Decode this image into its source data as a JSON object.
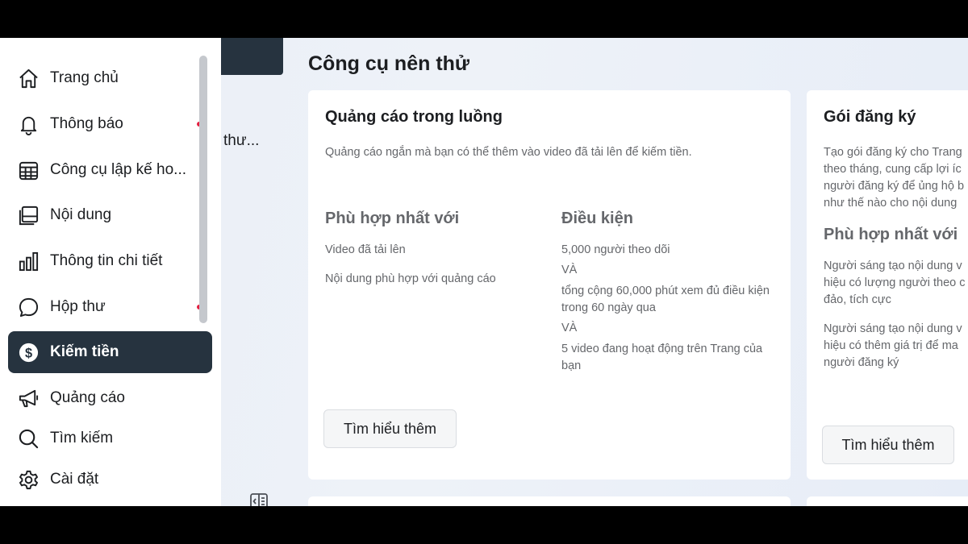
{
  "sidebar": {
    "items": [
      {
        "label": "Trang chủ",
        "icon": "home-icon"
      },
      {
        "label": "Thông báo",
        "icon": "bell-icon"
      },
      {
        "label": "Công cụ lập kế ho...",
        "icon": "calendar-icon"
      },
      {
        "label": "Nội dung",
        "icon": "content-icon"
      },
      {
        "label": "Thông tin chi tiết",
        "icon": "bar-chart-icon"
      },
      {
        "label": "Hộp thư",
        "icon": "chat-bubble-icon"
      },
      {
        "label": "Kiếm tiền",
        "icon": "dollar-icon"
      },
      {
        "label": "Quảng cáo",
        "icon": "megaphone-icon"
      },
      {
        "label": "Tìm kiếm",
        "icon": "search-icon"
      },
      {
        "label": "Cài đặt",
        "icon": "gear-icon"
      }
    ],
    "active_index": 6
  },
  "secondary": {
    "truncated_text": "thư..."
  },
  "main": {
    "section_title": "Công cụ nên thử",
    "cards": [
      {
        "title": "Quảng cáo trong luồng",
        "description": "Quảng cáo ngắn mà bạn có thể thêm vào video đã tải lên để kiếm tiền.",
        "best_for_heading": "Phù hợp nhất với",
        "best_for": [
          "Video đã tải lên",
          "Nội dung phù hợp với quảng cáo"
        ],
        "requirements_heading": "Điều kiện",
        "requirements": [
          "5,000 người theo dõi",
          "VÀ",
          "tổng cộng 60,000 phút xem đủ điều kiện trong 60 ngày qua",
          "VÀ",
          "5 video đang hoạt động trên Trang của bạn"
        ],
        "button": "Tìm hiểu thêm"
      },
      {
        "title": "Gói đăng ký",
        "description": "Tạo gói đăng ký cho Trang theo tháng, cung cấp lợi íc người đăng ký để ủng hộ b như thế nào cho nội dung",
        "best_for_heading": "Phù hợp nhất với",
        "best_for": [
          "Người sáng tạo nội dung v hiệu có lượng người theo c đảo, tích cực",
          "Người sáng tạo nội dung v hiệu có thêm giá trị để ma người đăng ký"
        ],
        "button": "Tìm hiểu thêm"
      }
    ]
  },
  "colors": {
    "active_bg": "#26333f",
    "notification_dot": "#e41e3f"
  }
}
